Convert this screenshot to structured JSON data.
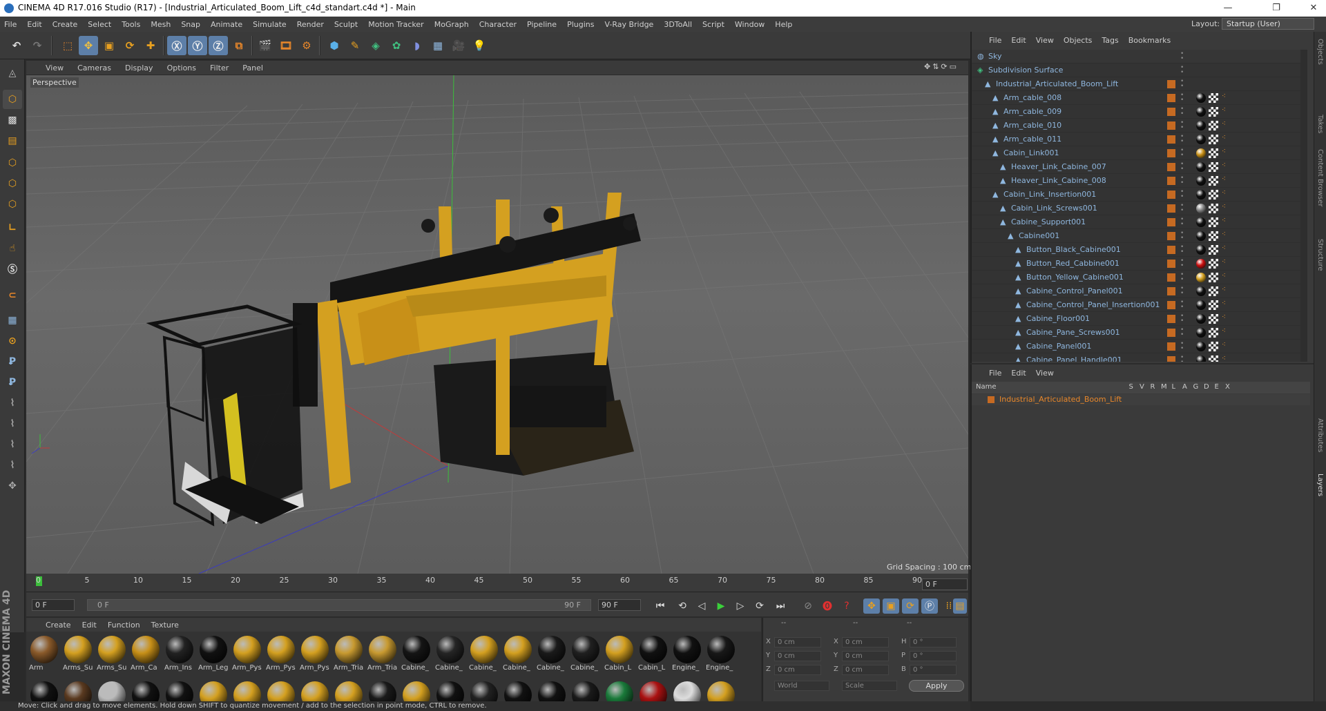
{
  "window": {
    "title": "CINEMA 4D R17.016 Studio (R17) - [Industrial_Articulated_Boom_Lift_c4d_standart.c4d *] - Main"
  },
  "menu": [
    "File",
    "Edit",
    "Create",
    "Select",
    "Tools",
    "Mesh",
    "Snap",
    "Animate",
    "Simulate",
    "Render",
    "Sculpt",
    "Motion Tracker",
    "MoGraph",
    "Character",
    "Pipeline",
    "Plugins",
    "V-Ray Bridge",
    "3DToAll",
    "Script",
    "Window",
    "Help"
  ],
  "layout": {
    "label": "Layout:",
    "value": "Startup (User)"
  },
  "viewport": {
    "menu": [
      "View",
      "Cameras",
      "Display",
      "Options",
      "Filter",
      "Panel"
    ],
    "label": "Perspective",
    "grid_spacing": "Grid Spacing : 100 cm"
  },
  "timeline": {
    "ticks": [
      "0",
      "5",
      "10",
      "15",
      "20",
      "25",
      "30",
      "35",
      "40",
      "45",
      "50",
      "55",
      "60",
      "65",
      "70",
      "75",
      "80",
      "85",
      "90"
    ],
    "end_frame": "0 F"
  },
  "playback": {
    "start": "0 F",
    "range_start": "0 F",
    "range_end": "90 F",
    "end": "90 F"
  },
  "materials": {
    "menu": [
      "Create",
      "Edit",
      "Function",
      "Texture"
    ],
    "row1": [
      {
        "label": "Arm",
        "color": "#8a5a2a"
      },
      {
        "label": "Arms_Su",
        "color": "#d4a020"
      },
      {
        "label": "Arms_Su",
        "color": "#d4a020"
      },
      {
        "label": "Arm_Ca",
        "color": "#c89018"
      },
      {
        "label": "Arm_Ins",
        "color": "#222222"
      },
      {
        "label": "Arm_Leg",
        "color": "#111111"
      },
      {
        "label": "Arm_Pys",
        "color": "#d4a020"
      },
      {
        "label": "Arm_Pys",
        "color": "#d4a020"
      },
      {
        "label": "Arm_Pys",
        "color": "#d4a020"
      },
      {
        "label": "Arm_Tria",
        "color": "#c89a30"
      },
      {
        "label": "Arm_Tria",
        "color": "#c89a30"
      },
      {
        "label": "Cabine_",
        "color": "#151515"
      },
      {
        "label": "Cabine_",
        "color": "#252525"
      },
      {
        "label": "Cabine_",
        "color": "#d4a020"
      },
      {
        "label": "Cabine_",
        "color": "#d4a020"
      },
      {
        "label": "Cabine_",
        "color": "#1a1a1a"
      },
      {
        "label": "Cabine_",
        "color": "#202020"
      },
      {
        "label": "Cabin_L",
        "color": "#d4a020"
      },
      {
        "label": "Cabin_L",
        "color": "#111111"
      },
      {
        "label": "Engine_",
        "color": "#111111"
      },
      {
        "label": "Engine_",
        "color": "#181818"
      }
    ],
    "row2": [
      "#111111",
      "#5a3a20",
      "#bbbbbb",
      "#111111",
      "#111111",
      "#d4a020",
      "#d4a020",
      "#d4a020",
      "#d4a020",
      "#d4a020",
      "#1a1a1a",
      "#d4a020",
      "#111111",
      "#222222",
      "#111111",
      "#111111",
      "#1a1a1a",
      "#1a7a3a",
      "#aa1111",
      "#dddddd",
      "#d4a020"
    ]
  },
  "coords": {
    "dash": "--",
    "rows": [
      {
        "a": "X",
        "av": "0 cm",
        "b": "X",
        "bv": "0 cm",
        "c": "H",
        "cv": "0 °"
      },
      {
        "a": "Y",
        "av": "0 cm",
        "b": "Y",
        "bv": "0 cm",
        "c": "P",
        "cv": "0 °"
      },
      {
        "a": "Z",
        "av": "0 cm",
        "b": "Z",
        "bv": "0 cm",
        "c": "B",
        "cv": "0 °"
      }
    ],
    "world": "World",
    "scale": "Scale",
    "apply": "Apply"
  },
  "status": "Move: Click and drag to move elements. Hold down SHIFT to quantize movement / add to the selection in point mode, CTRL to remove.",
  "object_manager": {
    "menu": [
      "File",
      "Edit",
      "View",
      "Objects",
      "Tags",
      "Bookmarks"
    ],
    "objects": [
      {
        "name": "Sky",
        "indent": 0,
        "tag": "none"
      },
      {
        "name": "Subdivision Surface",
        "indent": 0,
        "tag": "none"
      },
      {
        "name": "Industrial_Articulated_Boom_Lift",
        "indent": 1,
        "tag": "none"
      },
      {
        "name": "Arm_cable_008",
        "indent": 2,
        "tag": "#111111"
      },
      {
        "name": "Arm_cable_009",
        "indent": 2,
        "tag": "#111111"
      },
      {
        "name": "Arm_cable_010",
        "indent": 2,
        "tag": "#111111"
      },
      {
        "name": "Arm_cable_011",
        "indent": 2,
        "tag": "#111111"
      },
      {
        "name": "Cabin_Link001",
        "indent": 2,
        "tag": "#c89018"
      },
      {
        "name": "Heaver_Link_Cabine_007",
        "indent": 3,
        "tag": "#111111"
      },
      {
        "name": "Heaver_Link_Cabine_008",
        "indent": 3,
        "tag": "#111111"
      },
      {
        "name": "Cabin_Link_Insertion001",
        "indent": 2,
        "tag": "#111111"
      },
      {
        "name": "Cabin_Link_Screws001",
        "indent": 3,
        "tag": "#888888"
      },
      {
        "name": "Cabine_Support001",
        "indent": 3,
        "tag": "#111111"
      },
      {
        "name": "Cabine001",
        "indent": 4,
        "tag": "#111111"
      },
      {
        "name": "Button_Black_Cabine001",
        "indent": 5,
        "tag": "#111111"
      },
      {
        "name": "Button_Red_Cabbine001",
        "indent": 5,
        "tag": "#cc1111"
      },
      {
        "name": "Button_Yellow_Cabine001",
        "indent": 5,
        "tag": "#d4a020"
      },
      {
        "name": "Cabine_Control_Panel001",
        "indent": 5,
        "tag": "#111111"
      },
      {
        "name": "Cabine_Control_Panel_Insertion001",
        "indent": 5,
        "tag": "#111111"
      },
      {
        "name": "Cabine_Floor001",
        "indent": 5,
        "tag": "#111111"
      },
      {
        "name": "Cabine_Pane_Screws001",
        "indent": 5,
        "tag": "#111111"
      },
      {
        "name": "Cabine_Panel001",
        "indent": 5,
        "tag": "#111111"
      },
      {
        "name": "Cabine_Panel_Handle001",
        "indent": 5,
        "tag": "#111111"
      }
    ]
  },
  "layer_manager": {
    "menu": [
      "File",
      "Edit",
      "View"
    ],
    "columns": [
      "Name",
      "S",
      "V",
      "R",
      "M",
      "L",
      "A",
      "G",
      "D",
      "E",
      "X"
    ],
    "layer": "Industrial_Articulated_Boom_Lift"
  },
  "right_tabs": [
    "Objects",
    "Takes",
    "Content Browser",
    "Structure",
    "Attributes",
    "Layers"
  ]
}
